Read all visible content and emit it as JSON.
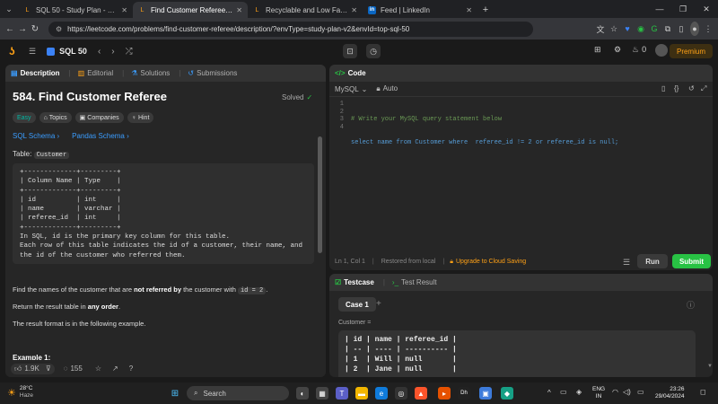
{
  "browser": {
    "tabs": [
      {
        "title": "SQL 50 - Study Plan - LeetCode",
        "fav": "L",
        "fav_color": "#ffa116"
      },
      {
        "title": "Find Customer Referee - LeetC",
        "fav": "L",
        "fav_color": "#ffa116"
      },
      {
        "title": "Recyclable and Low Fat Product",
        "fav": "L",
        "fav_color": "#ffa116"
      },
      {
        "title": "Feed | LinkedIn",
        "fav": "in",
        "fav_color": "#0a66c2"
      }
    ],
    "url": "https://leetcode.com/problems/find-customer-referee/description/?envType=study-plan-v2&envId=top-sql-50"
  },
  "header": {
    "plan_title": "SQL 50",
    "streak": "0",
    "premium": "Premium"
  },
  "left": {
    "tabs": [
      "Description",
      "Editorial",
      "Solutions",
      "Submissions"
    ],
    "problem_title": "584. Find Customer Referee",
    "solved": "Solved",
    "chips": [
      "Easy",
      "Topics",
      "Companies",
      "Hint"
    ],
    "schema_links": [
      "SQL Schema",
      "Pandas Schema"
    ],
    "table_label": "Table:",
    "table_name": "Customer",
    "schema_block": "+-------------+---------+\n| Column Name | Type    |\n+-------------+---------+\n| id          | int     |\n| name        | varchar |\n| referee_id  | int     |\n+-------------+---------+\nIn SQL, id is the primary key column for this table.\nEach row of this table indicates the id of a customer, their name, and\nthe id of the customer who referred them.",
    "p1_a": "Find the names of the customer that are ",
    "p1_b": "not referred by",
    "p1_c": " the customer with ",
    "p1_code": "id = 2",
    "p1_d": ".",
    "p2_a": "Return the result table in ",
    "p2_b": "any order",
    "p2_c": ".",
    "p3": "The result format is in the following example.",
    "example": "Example 1:",
    "likes": "1.9K",
    "comments": "155"
  },
  "code": {
    "title": "Code",
    "lang": "MySQL",
    "mode": "Auto",
    "line_numbers": [
      "1",
      "2",
      "3",
      "4"
    ],
    "line1": "# Write your MySQL query statement below",
    "line2": "select name from Customer where  referee_id != 2 or referee_id is null;",
    "status": "Ln 1, Col 1",
    "restored": "Restored from local",
    "upgrade": "Upgrade to Cloud Saving",
    "run": "Run",
    "submit": "Submit"
  },
  "testcase": {
    "tab1": "Testcase",
    "tab2": "Test Result",
    "case": "Case 1",
    "label": "Customer =",
    "table": "| id | name | referee_id |\n| -- | ---- | ---------- |\n| 1  | Will | null       |\n| 2  | Jane | null       |"
  },
  "taskbar": {
    "temp": "28°C",
    "weather": "Haze",
    "search": "Search",
    "lang1": "ENG",
    "lang2": "IN",
    "time": "23:26",
    "date": "29/04/2024"
  },
  "colors": {
    "accent_orange": "#ffa116",
    "easy_green": "#00b8a3",
    "submit_green": "#28c244",
    "link_blue": "#3b9dff"
  }
}
